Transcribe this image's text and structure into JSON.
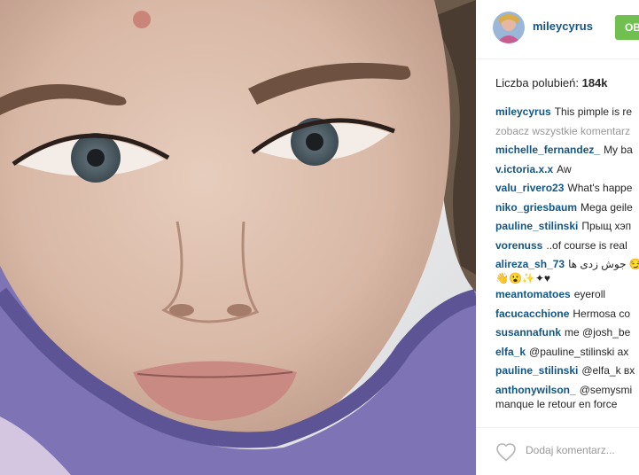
{
  "post": {
    "author": "mileycyrus",
    "follow_label": "OB",
    "likes_label": "Liczba polubień:",
    "likes_count": "184k",
    "caption_text": "This pimple is re",
    "view_all_comments": "zobacz wszystkie komentarz",
    "comments": [
      {
        "user": "michelle_fernandez_",
        "text": "My ba"
      },
      {
        "user": "v.ictoria.x.x",
        "text": "Aw"
      },
      {
        "user": "valu_rivero23",
        "text": "What's happe"
      },
      {
        "user": "niko_griesbaum",
        "text": "Mega geile"
      },
      {
        "user": "pauline_stilinski",
        "text": "Прыщ хэп"
      },
      {
        "user": "vorenuss",
        "text": "..of course is real"
      },
      {
        "user": "alireza_sh_73",
        "text": "جوش زدی ها 😏",
        "text2": "👋😮✨✦♥"
      },
      {
        "user": "meantomatoes",
        "text": "eyeroll"
      },
      {
        "user": "facucacchione",
        "text": "Hermosa co"
      },
      {
        "user": "susannafunk",
        "text": "me @josh_be"
      },
      {
        "user": "elfa_k",
        "text": "@pauline_stilinski ax"
      },
      {
        "user": "pauline_stilinski",
        "text": "@elfa_k вх"
      },
      {
        "user": "anthonywilson_",
        "text": "@semysmi",
        "text2": "manque le retour en force"
      }
    ],
    "add_comment_placeholder": "Dodaj komentarz..."
  },
  "icons": {
    "like": "heart-outline-icon"
  },
  "colors": {
    "username": "#125688",
    "follow_bg": "#70c050",
    "muted": "#999999"
  }
}
